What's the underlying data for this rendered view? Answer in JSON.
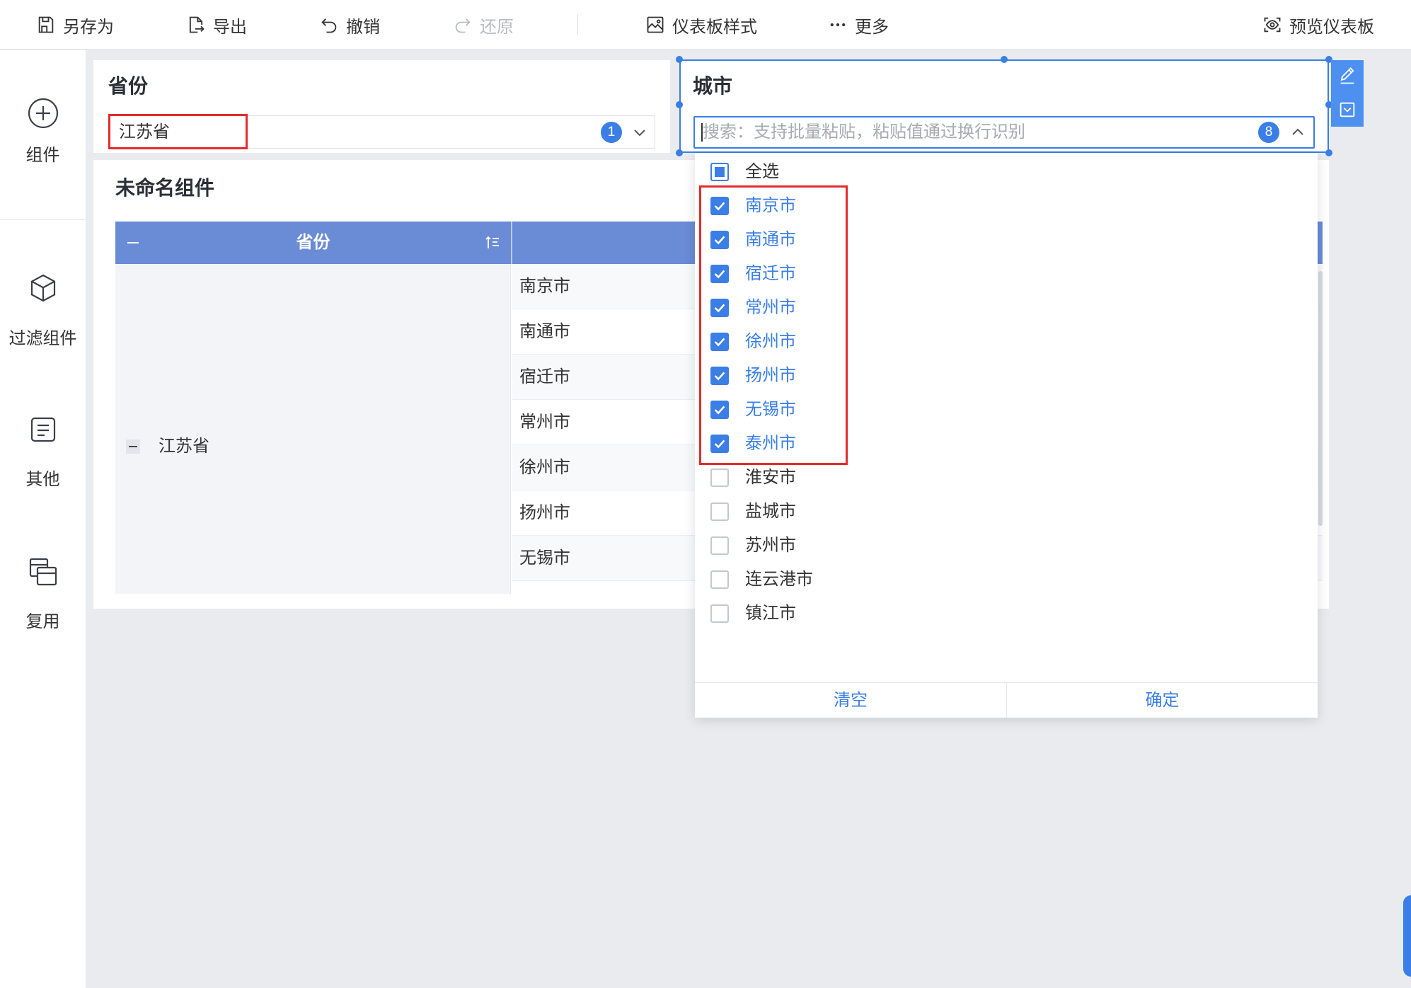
{
  "colors": {
    "accent": "#3a7ee6",
    "table_header": "#6a8bd5",
    "highlight_box": "#e32b2b",
    "tool_panel": "#4d90f0"
  },
  "toolbar": {
    "save_as": {
      "label": "另存为",
      "icon": "save-icon"
    },
    "export": {
      "label": "导出",
      "icon": "export-icon"
    },
    "undo": {
      "label": "撤销",
      "icon": "undo-icon"
    },
    "redo": {
      "label": "还原",
      "icon": "redo-icon",
      "disabled": true
    },
    "dashboard_style": {
      "label": "仪表板样式",
      "icon": "style-icon"
    },
    "more": {
      "label": "更多",
      "icon": "more-dots-icon"
    },
    "preview": {
      "label": "预览仪表板",
      "icon": "preview-icon"
    }
  },
  "sidebar": {
    "items": [
      {
        "label": "组件",
        "icon": "plus-circle-icon"
      },
      {
        "label": "过滤组件",
        "icon": "cube-icon"
      },
      {
        "label": "其他",
        "icon": "document-icon"
      },
      {
        "label": "复用",
        "icon": "copy-icon"
      }
    ]
  },
  "province_filter": {
    "title": "省份",
    "value": "江苏省",
    "selected_count": "1"
  },
  "city_filter": {
    "title": "城市",
    "search_placeholder": "搜索：支持批量粘贴，粘贴值通过换行识别",
    "selected_count": "8",
    "dropdown": {
      "select_all": {
        "label": "全选",
        "state": "partial"
      },
      "options": [
        {
          "label": "南京市",
          "checked": true
        },
        {
          "label": "南通市",
          "checked": true
        },
        {
          "label": "宿迁市",
          "checked": true
        },
        {
          "label": "常州市",
          "checked": true
        },
        {
          "label": "徐州市",
          "checked": true
        },
        {
          "label": "扬州市",
          "checked": true
        },
        {
          "label": "无锡市",
          "checked": true
        },
        {
          "label": "泰州市",
          "checked": true
        },
        {
          "label": "淮安市",
          "checked": false
        },
        {
          "label": "盐城市",
          "checked": false
        },
        {
          "label": "苏州市",
          "checked": false
        },
        {
          "label": "连云港市",
          "checked": false
        },
        {
          "label": "镇江市",
          "checked": false
        }
      ],
      "clear_label": "清空",
      "confirm_label": "确定"
    }
  },
  "table_widget": {
    "title": "未命名组件",
    "header": {
      "province": "省份"
    },
    "province": "江苏省",
    "cities": [
      "南京市",
      "南通市",
      "宿迁市",
      "常州市",
      "徐州市",
      "扬州市",
      "无锡市"
    ]
  }
}
